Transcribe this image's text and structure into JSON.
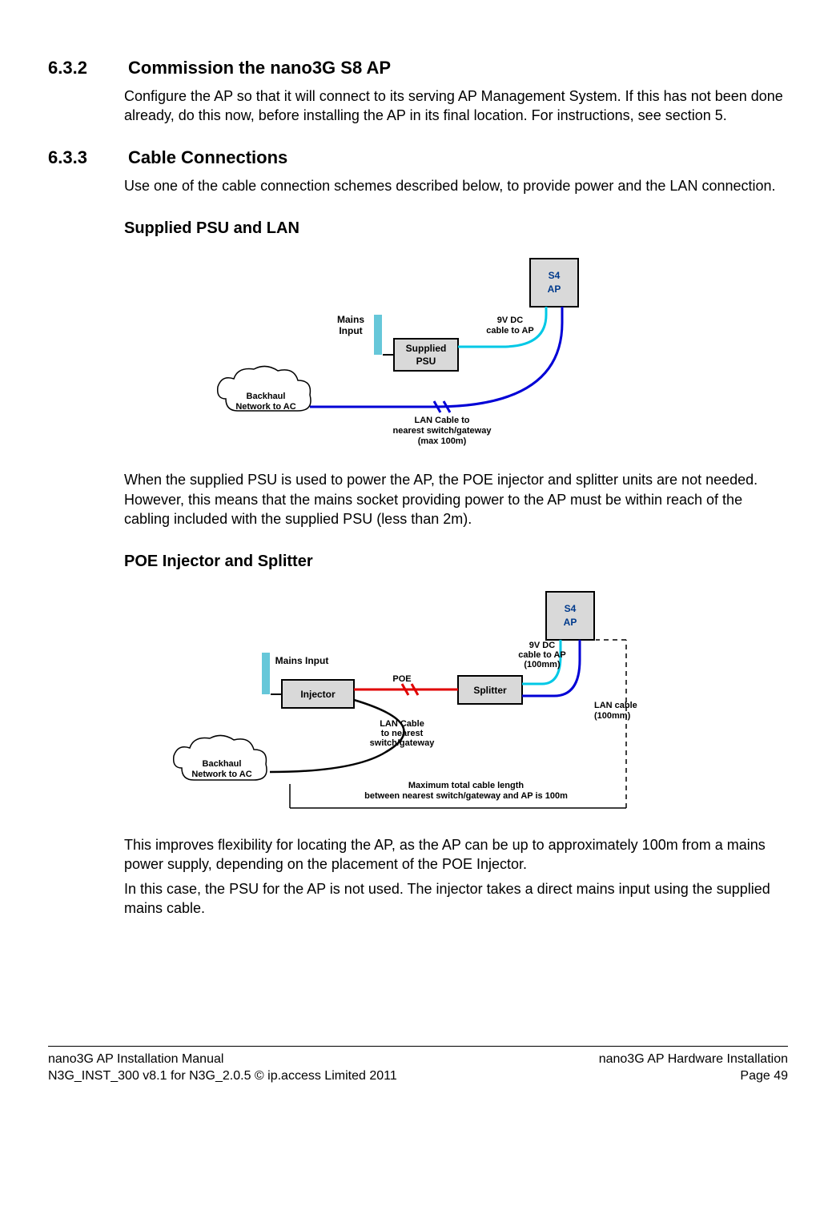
{
  "sec632": {
    "num": "6.3.2",
    "title": "Commission the nano3G S8 AP",
    "p1": "Configure the AP so that it will connect to its serving AP Management System. If this has not been done already, do this now, before installing the AP in its final location. For instructions, see section 5."
  },
  "sec633": {
    "num": "6.3.3",
    "title": "Cable Connections",
    "p1": "Use one of the cable connection schemes described below, to provide power and the LAN connection.",
    "sub1": "Supplied PSU and LAN",
    "sub2": "POE Injector and Splitter",
    "p_sub1": "When the supplied PSU is used to power the AP, the POE injector and splitter units are not needed. However, this means that the mains socket providing power to the AP must be within reach of the cabling included with the supplied PSU (less than 2m).",
    "p_sub2a": "This improves flexibility for locating the AP, as the AP can be up to approximately 100m from a mains power supply, depending on the placement of the POE Injector.",
    "p_sub2b": "In this case, the PSU for the AP is not used. The injector takes a direct mains input using the supplied mains cable."
  },
  "diag1": {
    "ap_l1": "S4",
    "ap_l2": "AP",
    "mains_l1": "Mains",
    "mains_l2": "Input",
    "psu_l1": "Supplied",
    "psu_l2": "PSU",
    "dc_l1": "9V DC",
    "dc_l2": "cable to AP",
    "lan_l1": "LAN Cable to",
    "lan_l2": "nearest switch/gateway",
    "lan_l3": "(max 100m)",
    "cloud_l1": "Backhaul",
    "cloud_l2": "Network to AC"
  },
  "diag2": {
    "ap_l1": "S4",
    "ap_l2": "AP",
    "mains": "Mains Input",
    "injector": "Injector",
    "splitter": "Splitter",
    "poe": "POE",
    "dc_l1": "9V DC",
    "dc_l2": "cable to AP",
    "dc_l3": "(100mm)",
    "lan2_l1": "LAN cable",
    "lan2_l2": "(100mm)",
    "lan1_l1": "LAN Cable",
    "lan1_l2": "to nearest",
    "lan1_l3": "switch/gateway",
    "max_l1": "Maximum total cable length",
    "max_l2": "between nearest switch/gateway and AP is 100m",
    "cloud_l1": "Backhaul",
    "cloud_l2": "Network to AC"
  },
  "footer": {
    "l1": "nano3G AP Installation Manual",
    "l2": "N3G_INST_300 v8.1 for N3G_2.0.5 © ip.access Limited 2011",
    "r1": "nano3G AP Hardware Installation",
    "r2": "Page 49"
  }
}
